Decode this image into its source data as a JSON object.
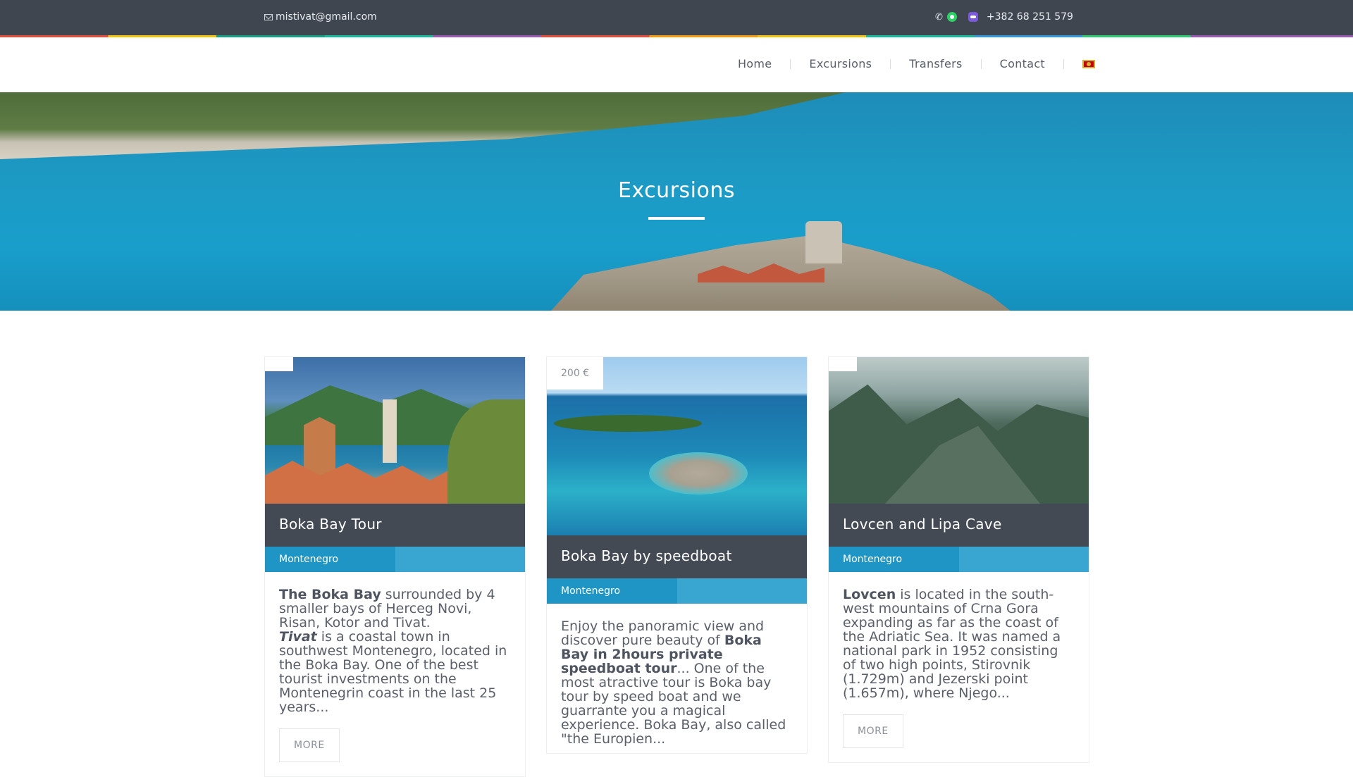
{
  "topbar": {
    "email": "mistivat@gmail.com",
    "phone": "+382 68 251 579"
  },
  "nav": {
    "items": [
      "Home",
      "Excursions",
      "Transfers",
      "Contact"
    ]
  },
  "hero": {
    "title": "Excursions"
  },
  "cards": [
    {
      "price": "",
      "title": "Boka Bay Tour",
      "location": "Montenegro",
      "desc": {
        "b1": "The Boka Bay",
        "t1": " surrounded by 4 smaller bays of Herceg Novi, Risan, Kotor and Tivat.",
        "bi": "Tivat",
        "t2": " is a coastal town in southwest Montenegro, located in the Boka Bay. One of the best tourist investments on the Montenegrin coast in the last 25 years..."
      },
      "more": "MORE"
    },
    {
      "price": "200 €",
      "title": "Boka Bay by speedboat",
      "location": "Montenegro",
      "desc": {
        "t1": "Enjoy the panoramic view and discover pure beauty of ",
        "b1": "Boka Bay in 2hours private speedboat tour",
        "t2": "... One of the most atractive tour is Boka bay tour by speed boat and we guarrante you a magical experience. Boka Bay, also called \"the Europien..."
      }
    },
    {
      "price": "",
      "title": "Lovcen and Lipa Cave",
      "location": "Montenegro",
      "desc": {
        "b1": "Lovcen",
        "t1": " is located in the south-west mountains of Crna Gora expanding as far as the coast of the Adriatic Sea. It was named a national park in 1952 consisting of two high points, Stirovnik (1.729m) and Jezerski point (1.657m), where Njego..."
      },
      "more": "MORE"
    }
  ],
  "icons": [
    "mail-icon",
    "phone-icon",
    "whatsapp-icon",
    "viber-icon",
    "montenegro-flag-icon"
  ],
  "colors": {
    "topbar": "#3f4650",
    "card_title_bg": "#434a54",
    "location_bg": "#1e95c4",
    "location_bg_light": "#38a6d1"
  }
}
